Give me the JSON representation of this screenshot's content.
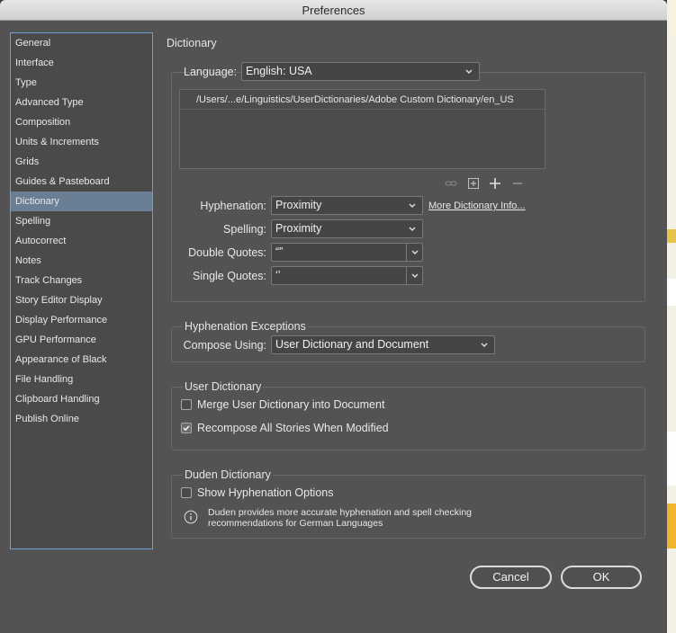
{
  "window": {
    "title": "Preferences"
  },
  "sidebar": {
    "items": [
      {
        "label": "General"
      },
      {
        "label": "Interface"
      },
      {
        "label": "Type"
      },
      {
        "label": "Advanced Type"
      },
      {
        "label": "Composition"
      },
      {
        "label": "Units & Increments"
      },
      {
        "label": "Grids"
      },
      {
        "label": "Guides & Pasteboard"
      },
      {
        "label": "Dictionary",
        "selected": true
      },
      {
        "label": "Spelling"
      },
      {
        "label": "Autocorrect"
      },
      {
        "label": "Notes"
      },
      {
        "label": "Track Changes"
      },
      {
        "label": "Story Editor Display"
      },
      {
        "label": "Display Performance"
      },
      {
        "label": "GPU Performance"
      },
      {
        "label": "Appearance of Black"
      },
      {
        "label": "File Handling"
      },
      {
        "label": "Clipboard Handling"
      },
      {
        "label": "Publish Online"
      }
    ]
  },
  "dictionary": {
    "title": "Dictionary",
    "language_label": "Language:",
    "language_value": "English: USA",
    "path": "/Users/...e/Linguistics/UserDictionaries/Adobe Custom Dictionary/en_US",
    "icons": [
      "link-icon",
      "add-dictionary-icon",
      "plus-icon",
      "minus-icon"
    ],
    "hyphenation_label": "Hyphenation:",
    "hyphenation_value": "Proximity",
    "more_info_link": "More Dictionary Info...",
    "spelling_label": "Spelling:",
    "spelling_value": "Proximity",
    "double_quotes_label": "Double Quotes:",
    "double_quotes_value": "“”",
    "single_quotes_label": "Single Quotes:",
    "single_quotes_value": "‘’"
  },
  "hyphenation_exceptions": {
    "title": "Hyphenation Exceptions",
    "compose_label": "Compose Using:",
    "compose_value": "User Dictionary and Document"
  },
  "user_dictionary": {
    "title": "User Dictionary",
    "merge_label": "Merge User Dictionary into Document",
    "merge_checked": false,
    "recompose_label": "Recompose All Stories When Modified",
    "recompose_checked": true
  },
  "duden": {
    "title": "Duden Dictionary",
    "show_label": "Show Hyphenation Options",
    "show_checked": false,
    "info_text_1": "Duden provides more accurate hyphenation and spell checking",
    "info_text_2": "recommendations for German Languages"
  },
  "buttons": {
    "cancel": "Cancel",
    "ok": "OK"
  },
  "colors": {
    "panel": "#535353",
    "selection": "#6b7f94",
    "focus_ring": "#6f9fd6"
  }
}
